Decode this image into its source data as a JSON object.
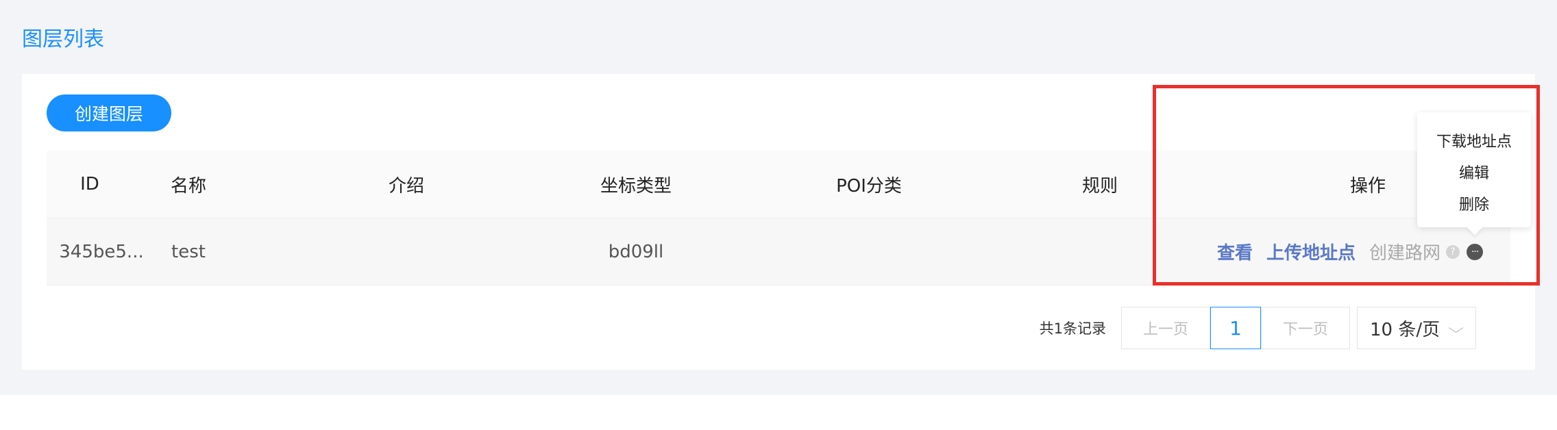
{
  "page": {
    "title": "图层列表"
  },
  "toolbar": {
    "create_label": "创建图层"
  },
  "table": {
    "columns": [
      "ID",
      "名称",
      "介绍",
      "坐标类型",
      "POI分类",
      "规则",
      "操作"
    ],
    "rows": [
      {
        "id": "345be5...",
        "name": "test",
        "intro": "",
        "coord_type": "bd09ll",
        "poi_category": "",
        "rule": ""
      }
    ],
    "row_actions": {
      "view": "查看",
      "upload": "上传地址点",
      "create_road": "创建路网",
      "help_glyph": "?",
      "more_glyph": "···"
    }
  },
  "dropdown": {
    "items": [
      "下载地址点",
      "编辑",
      "删除"
    ]
  },
  "pagination": {
    "total_text": "共1条记录",
    "prev_label": "上一页",
    "current_page": "1",
    "next_label": "下一页",
    "page_size_label": "10 条/页",
    "chevron_glyph": "⌵"
  },
  "colors": {
    "accent": "#1890ff",
    "link": "#5a78c8",
    "highlight": "#e8312b"
  }
}
